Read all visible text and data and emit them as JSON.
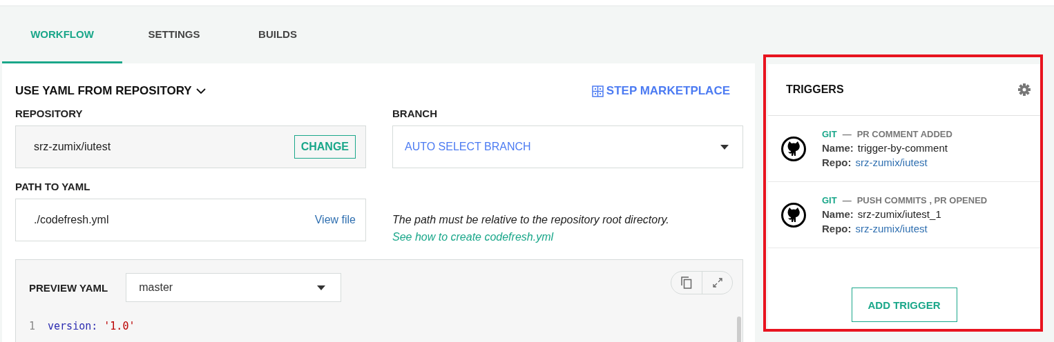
{
  "tabs": [
    {
      "label": "WORKFLOW",
      "selected": true
    },
    {
      "label": "SETTINGS",
      "selected": false
    },
    {
      "label": "BUILDS",
      "selected": false
    }
  ],
  "workflow": {
    "source_menu": "USE YAML FROM REPOSITORY",
    "marketplace_link": "STEP MARKETPLACE",
    "repository": {
      "label": "REPOSITORY",
      "value": "srz-zumix/iutest",
      "button": "CHANGE"
    },
    "branch": {
      "label": "BRANCH",
      "value": "AUTO SELECT BRANCH"
    },
    "path": {
      "label": "PATH TO YAML",
      "value": "./codefresh.yml",
      "link": "View file"
    },
    "hint": {
      "text": "The path must be relative to the repository root directory.",
      "link": "See how to create codefresh.yml"
    },
    "preview": {
      "label": "PREVIEW YAML",
      "branch": "master",
      "code_lines": [
        {
          "number": "1",
          "key": "version:",
          "value": "'1.0'"
        }
      ]
    }
  },
  "triggers": {
    "title": "TRIGGERS",
    "items": [
      {
        "type": "GIT",
        "dash": "—",
        "events": "PR COMMENT ADDED",
        "name_label": "Name:",
        "name": "trigger-by-comment",
        "repo_label": "Repo:",
        "repo": "srz-zumix/iutest"
      },
      {
        "type": "GIT",
        "dash": "—",
        "events": "PUSH COMMITS , PR OPENED",
        "name_label": "Name:",
        "name": "srz-zumix/iutest_1",
        "repo_label": "Repo:",
        "repo": "srz-zumix/iutest"
      }
    ],
    "add_button": "ADD TRIGGER"
  }
}
